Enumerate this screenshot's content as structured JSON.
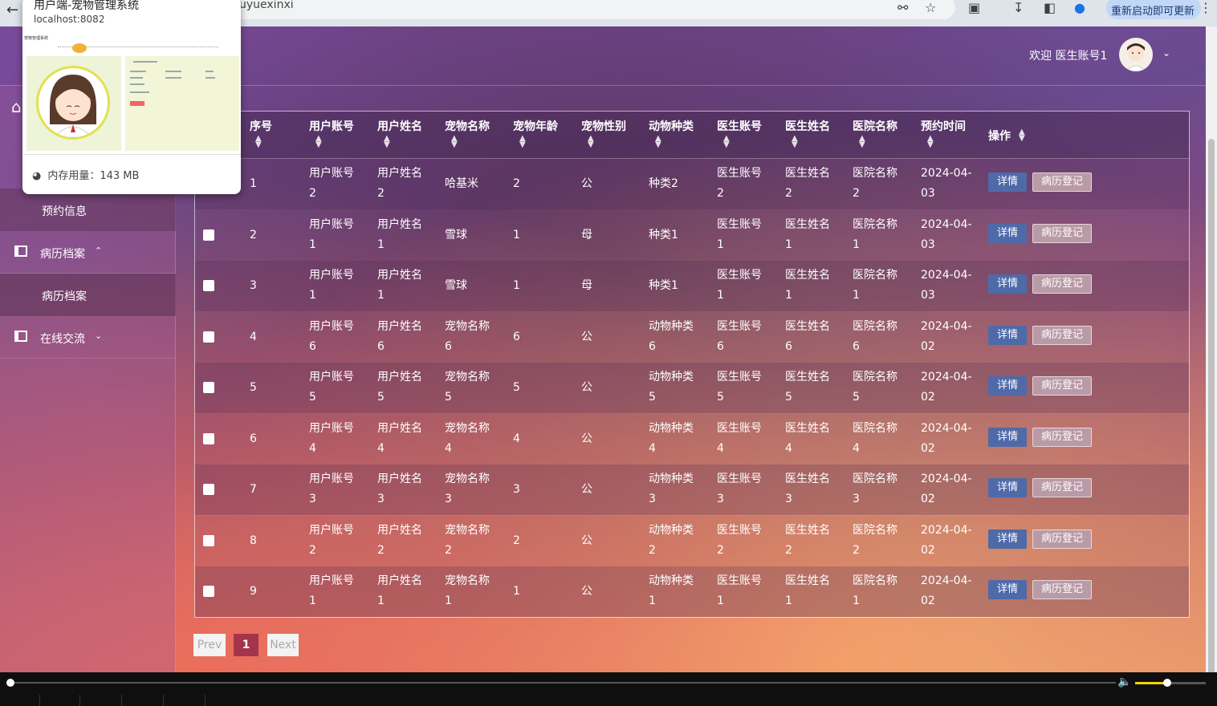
{
  "browser": {
    "url_fragment": "uyuexinxi",
    "update_label": "重新启动即可更新"
  },
  "tab_preview": {
    "title": "用户端-宠物管理系统",
    "host": "localhost:8082",
    "memory": "内存用量：143 MB",
    "thumb_name": "宠物管理系统"
  },
  "header": {
    "welcome": "欢迎 医生账号1"
  },
  "sidebar": {
    "sub_prev": "预约信息",
    "items": [
      {
        "label": "病历档案",
        "chevron": "^"
      },
      {
        "label": "在线交流",
        "chevron": "v"
      }
    ],
    "sub_label": "病历档案"
  },
  "table": {
    "headers": [
      "序号",
      "用户账号",
      "用户姓名",
      "宠物名称",
      "宠物年龄",
      "宠物性别",
      "动物种类",
      "医生账号",
      "医生姓名",
      "医院名称",
      "预约时间",
      "操作"
    ],
    "detail_label": "详情",
    "record_label": "病历登记",
    "rows": [
      {
        "no": "1",
        "acct": "用户账号",
        "acct2": "2",
        "name": "用户姓名",
        "name2": "2",
        "pet": "哈基米",
        "pet2": "",
        "age": "2",
        "sex": "公",
        "kind": "种类2",
        "kind2": "",
        "dacct": "医生账号",
        "dacct2": "2",
        "dname": "医生姓名",
        "dname2": "2",
        "hosp": "医院名称",
        "hosp2": "2",
        "date": "2024-04-",
        "date2": "03"
      },
      {
        "no": "2",
        "acct": "用户账号",
        "acct2": "1",
        "name": "用户姓名",
        "name2": "1",
        "pet": "雪球",
        "pet2": "",
        "age": "1",
        "sex": "母",
        "kind": "种类1",
        "kind2": "",
        "dacct": "医生账号",
        "dacct2": "1",
        "dname": "医生姓名",
        "dname2": "1",
        "hosp": "医院名称",
        "hosp2": "1",
        "date": "2024-04-",
        "date2": "03"
      },
      {
        "no": "3",
        "acct": "用户账号",
        "acct2": "1",
        "name": "用户姓名",
        "name2": "1",
        "pet": "雪球",
        "pet2": "",
        "age": "1",
        "sex": "母",
        "kind": "种类1",
        "kind2": "",
        "dacct": "医生账号",
        "dacct2": "1",
        "dname": "医生姓名",
        "dname2": "1",
        "hosp": "医院名称",
        "hosp2": "1",
        "date": "2024-04-",
        "date2": "03"
      },
      {
        "no": "4",
        "acct": "用户账号",
        "acct2": "6",
        "name": "用户姓名",
        "name2": "6",
        "pet": "宠物名称",
        "pet2": "6",
        "age": "6",
        "sex": "公",
        "kind": "动物种类",
        "kind2": "6",
        "dacct": "医生账号",
        "dacct2": "6",
        "dname": "医生姓名",
        "dname2": "6",
        "hosp": "医院名称",
        "hosp2": "6",
        "date": "2024-04-",
        "date2": "02"
      },
      {
        "no": "5",
        "acct": "用户账号",
        "acct2": "5",
        "name": "用户姓名",
        "name2": "5",
        "pet": "宠物名称",
        "pet2": "5",
        "age": "5",
        "sex": "公",
        "kind": "动物种类",
        "kind2": "5",
        "dacct": "医生账号",
        "dacct2": "5",
        "dname": "医生姓名",
        "dname2": "5",
        "hosp": "医院名称",
        "hosp2": "5",
        "date": "2024-04-",
        "date2": "02"
      },
      {
        "no": "6",
        "acct": "用户账号",
        "acct2": "4",
        "name": "用户姓名",
        "name2": "4",
        "pet": "宠物名称",
        "pet2": "4",
        "age": "4",
        "sex": "公",
        "kind": "动物种类",
        "kind2": "4",
        "dacct": "医生账号",
        "dacct2": "4",
        "dname": "医生姓名",
        "dname2": "4",
        "hosp": "医院名称",
        "hosp2": "4",
        "date": "2024-04-",
        "date2": "02"
      },
      {
        "no": "7",
        "acct": "用户账号",
        "acct2": "3",
        "name": "用户姓名",
        "name2": "3",
        "pet": "宠物名称",
        "pet2": "3",
        "age": "3",
        "sex": "公",
        "kind": "动物种类",
        "kind2": "3",
        "dacct": "医生账号",
        "dacct2": "3",
        "dname": "医生姓名",
        "dname2": "3",
        "hosp": "医院名称",
        "hosp2": "3",
        "date": "2024-04-",
        "date2": "02"
      },
      {
        "no": "8",
        "acct": "用户账号",
        "acct2": "2",
        "name": "用户姓名",
        "name2": "2",
        "pet": "宠物名称",
        "pet2": "2",
        "age": "2",
        "sex": "公",
        "kind": "动物种类",
        "kind2": "2",
        "dacct": "医生账号",
        "dacct2": "2",
        "dname": "医生姓名",
        "dname2": "2",
        "hosp": "医院名称",
        "hosp2": "2",
        "date": "2024-04-",
        "date2": "02"
      },
      {
        "no": "9",
        "acct": "用户账号",
        "acct2": "1",
        "name": "用户姓名",
        "name2": "1",
        "pet": "宠物名称",
        "pet2": "1",
        "age": "1",
        "sex": "公",
        "kind": "动物种类",
        "kind2": "1",
        "dacct": "医生账号",
        "dacct2": "1",
        "dname": "医生姓名",
        "dname2": "1",
        "hosp": "医院名称",
        "hosp2": "1",
        "date": "2024-04-",
        "date2": "02"
      }
    ]
  },
  "pagination": {
    "prev": "Prev",
    "current": "1",
    "next": "Next"
  },
  "icons": [
    "back-icon",
    "key-icon",
    "star-icon",
    "extension-icon",
    "download-icon",
    "sidepanel-icon",
    "profile-icon",
    "kebab-icon",
    "home-icon",
    "gauge-icon",
    "volume-icon"
  ],
  "colors": {
    "accent_detail": "#4f6aa8",
    "accent_record": "#b99aa6",
    "page_current": "#a4344a",
    "volume_fill": "#f1d100"
  },
  "media": {
    "volume_level": 0.45,
    "progress": 0.0
  }
}
